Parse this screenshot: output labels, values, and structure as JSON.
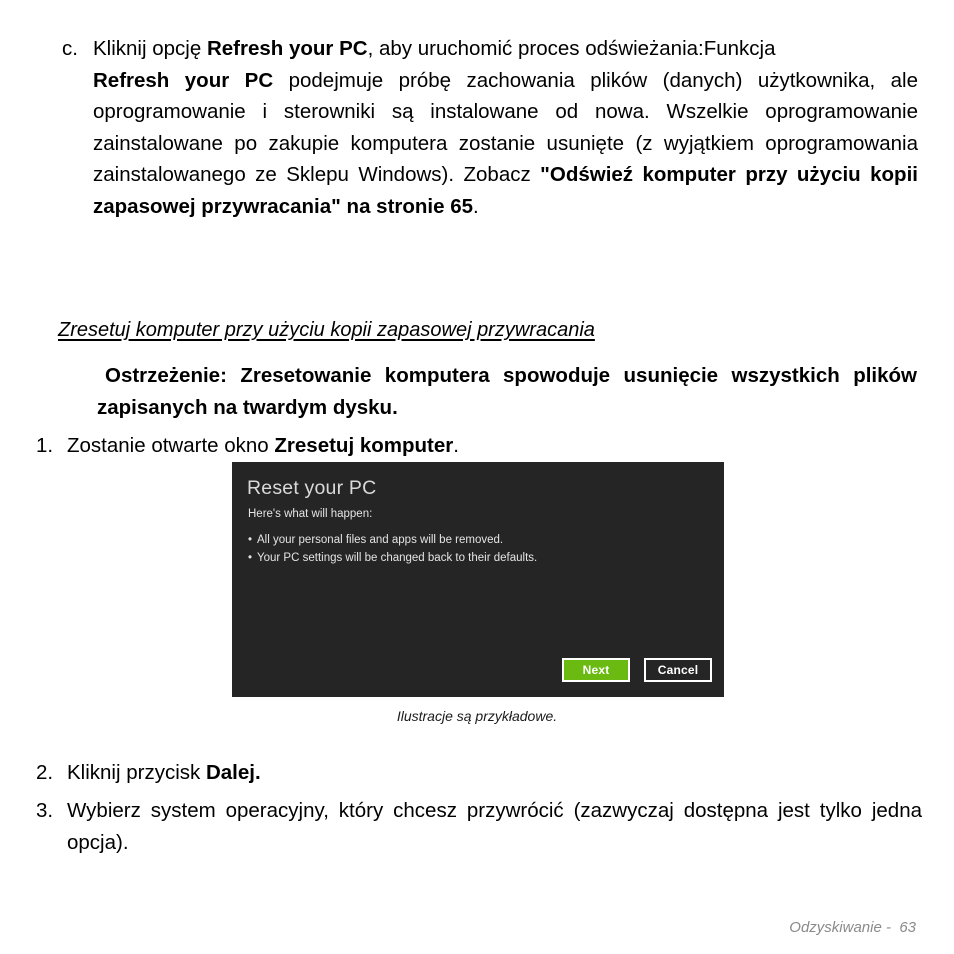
{
  "document": {
    "item_c": {
      "marker": "c.",
      "line1_pre": "Kliknij opcję ",
      "line1_bold": "Refresh your PC",
      "line1_post": ", aby uruchomić proces odświeżania:Funkcja",
      "para2_bold": "Refresh your PC",
      "para2_mid": " podejmuje próbę zachowania plików (danych) użytkownika, ale oprogramowanie i sterowniki są instalowane od nowa. Wszelkie oprogramowanie zainstalowane po zakupie komputera zostanie usunięte (z wyjątkiem oprogramowania zainstalowanego ze Sklepu Windows). Zobacz ",
      "para2_bold2": "\"Odświeź komputer przy użyciu kopii zapasowej przywracania\" na stronie 65",
      "para2_end": "."
    },
    "subheading": "Zresetuj komputer przy użyciu kopii zapasowej przywracania",
    "warning": {
      "line1_bold": "Ostrzeżenie: Zresetowanie komputera spowoduje usunięcie wszystkich plików zapisanych na twardym dysku."
    },
    "steps": [
      {
        "num": "1.",
        "text_pre": "Zostanie otwarte okno ",
        "text_bold": "Zresetuj komputer",
        "text_post": "."
      },
      {
        "num": "2.",
        "text_pre": "Kliknij przycisk ",
        "text_bold": "Dalej.",
        "text_post": ""
      },
      {
        "num": "3.",
        "text_pre": "Wybierz system operacyjny, który chcesz przywrócić (zazwyczaj dostępna jest tylko jedna opcja).",
        "text_bold": "",
        "text_post": ""
      }
    ],
    "figure": {
      "caption": "Ilustracje są przykładowe.",
      "screenshot": {
        "title": "Reset your PC",
        "subtitle": "Here's what will happen:",
        "bullets": [
          "All your personal files and apps will be removed.",
          "Your PC settings will be changed back to their defaults."
        ],
        "buttons": {
          "next": "Next",
          "cancel": "Cancel"
        },
        "colors": {
          "background": "#252525",
          "next_button": "#6aba12",
          "text": "#e4e4e4",
          "title_text": "#d9d9d9",
          "button_border": "#ffffff"
        }
      }
    },
    "footer": "Odzyskiwanie -  63"
  }
}
